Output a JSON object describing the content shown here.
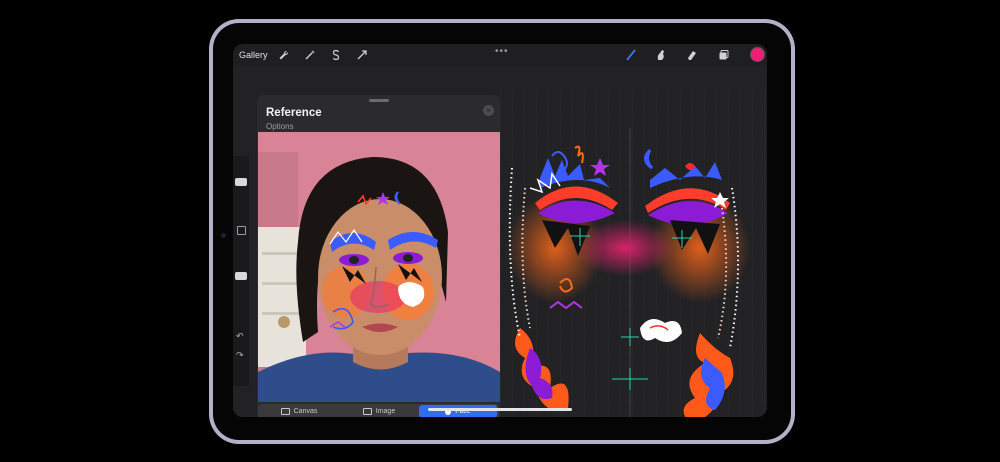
{
  "toolbar": {
    "gallery_label": "Gallery",
    "more_dots": "•••",
    "tools": [
      "adjust-wrench-icon",
      "magic-wand-icon",
      "selection-s-icon",
      "transform-arrow-icon"
    ],
    "right_tools": [
      "brush-icon",
      "smudge-icon",
      "eraser-icon",
      "layers-icon"
    ],
    "active_color": "#ee1f72",
    "accent_color": "#2f6ef2"
  },
  "sidebar": {
    "undo_glyph": "↶",
    "redo_glyph": "↷"
  },
  "reference_panel": {
    "title": "Reference",
    "options_label": "Options",
    "close_glyph": "×",
    "tabs": [
      {
        "label": "Canvas",
        "icon": "canvas-icon",
        "active": false
      },
      {
        "label": "Image",
        "icon": "image-icon",
        "active": false
      },
      {
        "label": "Face",
        "icon": "face-icon",
        "active": true
      }
    ]
  }
}
